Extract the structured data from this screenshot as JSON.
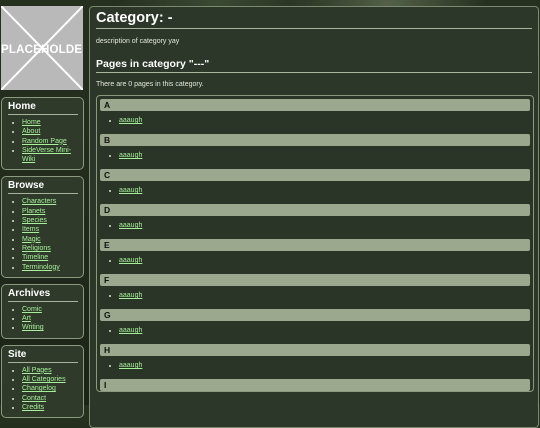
{
  "logo": {
    "text": "PLACEHOLDER"
  },
  "sidebar": [
    {
      "title": "Home",
      "items": [
        "Home",
        "About",
        "Random Page",
        "SideVerse Mini-Wiki"
      ]
    },
    {
      "title": "Browse",
      "items": [
        "Characters",
        "Planets",
        "Species",
        "Items",
        "Magic",
        "Religions",
        "Timeline",
        "Terminology"
      ]
    },
    {
      "title": "Archives",
      "items": [
        "Comic",
        "Art",
        "Writing"
      ]
    },
    {
      "title": "Site",
      "items": [
        "All Pages",
        "All Categories",
        "Changelog",
        "Contact",
        "Credits"
      ]
    }
  ],
  "main": {
    "title": "Category: -",
    "description": "description of category yay",
    "subtitle": "Pages in category \"---\"",
    "count_text": "There are 0 pages in this category.",
    "groups": [
      {
        "letter": "A",
        "items": [
          "aaaugh"
        ]
      },
      {
        "letter": "B",
        "items": [
          "aaaugh"
        ]
      },
      {
        "letter": "C",
        "items": [
          "aaaugh"
        ]
      },
      {
        "letter": "D",
        "items": [
          "aaaugh"
        ]
      },
      {
        "letter": "E",
        "items": [
          "aaaugh"
        ]
      },
      {
        "letter": "F",
        "items": [
          "aaaugh"
        ]
      },
      {
        "letter": "G",
        "items": [
          "aaaugh"
        ]
      },
      {
        "letter": "H",
        "items": [
          "aaaugh"
        ]
      },
      {
        "letter": "I",
        "items": []
      }
    ]
  },
  "colors": {
    "link": "#a6f09a",
    "letter_bar": "#9ba88d",
    "panel": "#2d3729"
  }
}
